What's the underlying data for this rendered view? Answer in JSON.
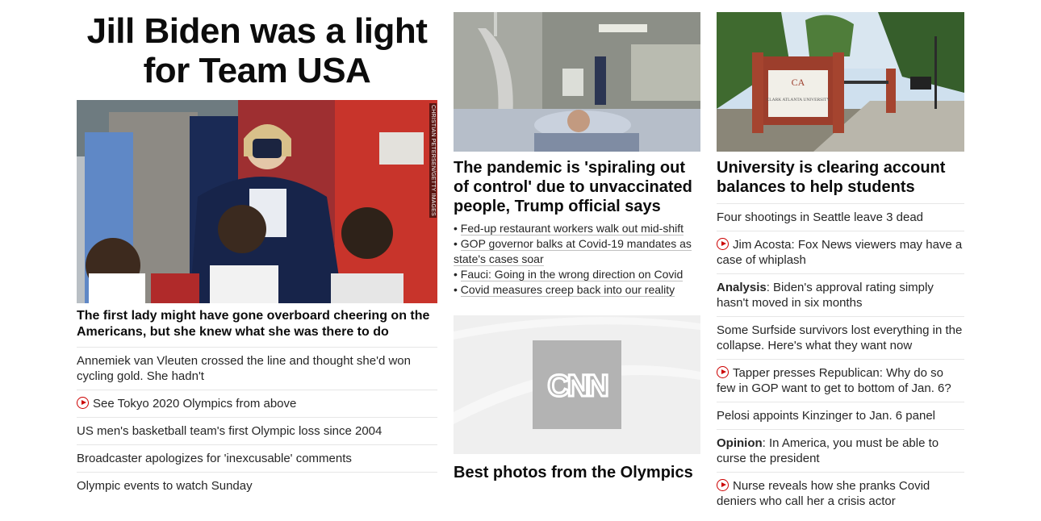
{
  "left": {
    "headline": "Jill Biden was a light for Team USA",
    "image_credit": "CHRISTIAN PETERSEN/GETTY IMAGES",
    "subheadline": "The first lady might have gone overboard cheering on the Americans, but she knew what she was there to do",
    "items": [
      {
        "text": "Annemiek van Vleuten crossed the line and thought she'd won cycling gold. She hadn't",
        "video": false
      },
      {
        "text": "See Tokyo 2020 Olympics from above",
        "video": true
      },
      {
        "text": "US men's basketball team's first Olympic loss since 2004",
        "video": false
      },
      {
        "text": "Broadcaster apologizes for 'inexcusable' comments",
        "video": false
      },
      {
        "text": "Olympic events to watch Sunday",
        "video": false
      }
    ]
  },
  "middle": {
    "headline": "The pandemic is 'spiraling out of control' due to unvaccinated people, Trump official says",
    "bullets": [
      "Fed-up restaurant workers walk out mid-shift",
      "GOP governor balks at Covid-19 mandates as state's cases soar",
      "Fauci: Going in the wrong direction on Covid",
      "Covid measures creep back into our reality"
    ],
    "cnn_logo_text": "CNN",
    "photos_headline": "Best photos from the Olympics"
  },
  "right": {
    "headline": "University is clearing account balances to help students",
    "sign_text": "CLARK ATLANTA UNIVERSITY",
    "sign_mark": "CA",
    "items": [
      {
        "lead": "",
        "text": "Four shootings in Seattle leave 3 dead",
        "video": false
      },
      {
        "lead": "",
        "text": "Jim Acosta: Fox News viewers may have a case of whiplash",
        "video": true
      },
      {
        "lead": "Analysis",
        "text": ": Biden's approval rating simply hasn't moved in six months",
        "video": false
      },
      {
        "lead": "",
        "text": "Some Surfside survivors lost everything in the collapse. Here's what they want now",
        "video": false
      },
      {
        "lead": "",
        "text": "Tapper presses Republican: Why do so few in GOP want to get to bottom of Jan. 6?",
        "video": true
      },
      {
        "lead": "",
        "text": "Pelosi appoints Kinzinger to Jan. 6 panel",
        "video": false
      },
      {
        "lead": "Opinion",
        "text": ": In America, you must be able to curse the president",
        "video": false
      },
      {
        "lead": "",
        "text": "Nurse reveals how she pranks Covid deniers who call her a crisis actor",
        "video": true
      }
    ]
  },
  "colors": {
    "accent_red": "#cc0000",
    "text": "#262626",
    "divider": "#e6e6e6"
  },
  "icons": {
    "video": "play-circle-icon",
    "brand": "cnn-logo-icon"
  }
}
